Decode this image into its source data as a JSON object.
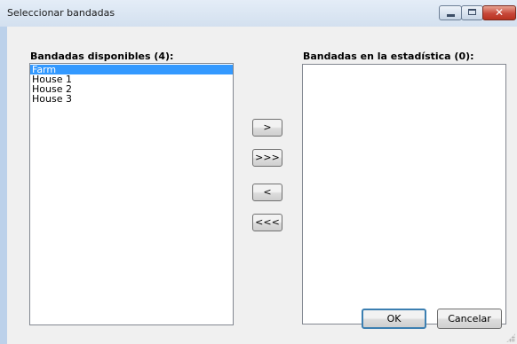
{
  "window": {
    "title": "Seleccionar bandadas",
    "close_glyph": "✕"
  },
  "available": {
    "label": "Bandadas disponibles (4):",
    "items": [
      "Farm",
      "House 1",
      "House 2",
      "House 3"
    ],
    "selected": "Farm"
  },
  "selected_list": {
    "label": "Bandadas en la estadística (0):",
    "items": []
  },
  "transfer": {
    "move_one": ">",
    "move_all": ">>>",
    "back_one": "<",
    "back_all": "<<<"
  },
  "buttons": {
    "ok": "OK",
    "cancel": "Cancelar"
  },
  "icons": {
    "minimize": "minimize-icon",
    "maximize": "maximize-icon",
    "close": "close-icon",
    "resize": "resize-grip-icon"
  },
  "colors": {
    "selection": "#3399ff",
    "close_button": "#c7483a",
    "titlebar": "#d3e0ef"
  }
}
